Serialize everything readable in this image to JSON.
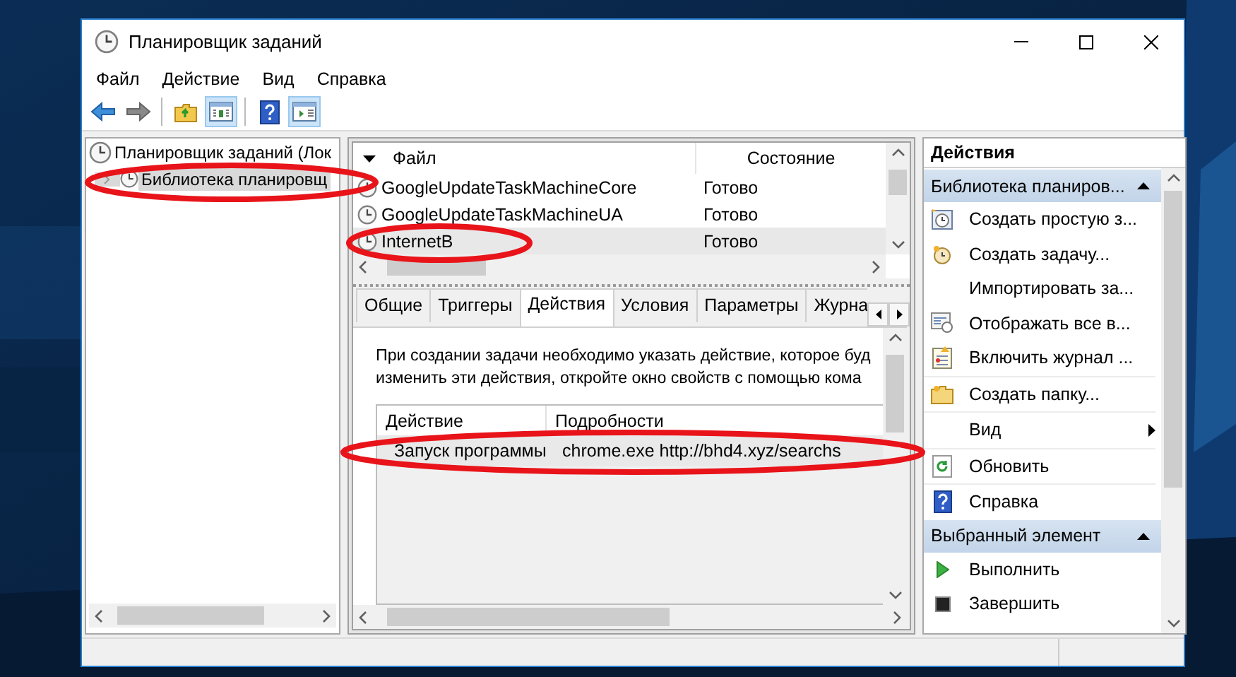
{
  "window": {
    "title": "Планировщик заданий"
  },
  "menu": [
    "Файл",
    "Действие",
    "Вид",
    "Справка"
  ],
  "toolbar": [
    {
      "pressed": false
    },
    {
      "pressed": false
    },
    {
      "pressed": false
    },
    {
      "pressed": true
    },
    {
      "pressed": false
    },
    {
      "pressed": true
    }
  ],
  "tree": [
    {
      "label": "Планировщик заданий (Лок",
      "selected": false,
      "children": [
        {
          "label": "Библиотека планировщ",
          "selected": true,
          "expanded": false
        }
      ]
    }
  ],
  "task_list": {
    "columns": [
      "Файл",
      "Состояние"
    ],
    "rows": [
      {
        "name": "GoogleUpdateTaskMachineCore",
        "status": "Готово",
        "selected": false
      },
      {
        "name": "GoogleUpdateTaskMachineUA",
        "status": "Готово",
        "selected": false
      },
      {
        "name": "InternetB",
        "status": "Готово",
        "selected": true
      }
    ]
  },
  "detail_tabs": [
    {
      "label": "Общие",
      "selected": false
    },
    {
      "label": "Триггеры",
      "selected": false
    },
    {
      "label": "Действия",
      "selected": true
    },
    {
      "label": "Условия",
      "selected": false
    },
    {
      "label": "Параметры",
      "selected": false
    },
    {
      "label": "Журна",
      "selected": false
    }
  ],
  "actions_tab": {
    "description": [
      "При создании задачи необходимо указать действие, которое буд",
      "изменить эти действия, откройте окно свойств с помощью кома"
    ],
    "table": {
      "columns": [
        "Действие",
        "Подробности"
      ],
      "rows": [
        {
          "action": "Запуск программы",
          "details": "chrome.exe http://bhd4.xyz/searchs"
        }
      ]
    }
  },
  "actions_pane": {
    "title": "Действия",
    "sections": [
      {
        "title": "Библиотека планиров...",
        "expanded": true,
        "items": [
          {
            "label": "Создать простую з...",
            "kind": "command"
          },
          {
            "label": "Создать задачу...",
            "kind": "command"
          },
          {
            "label": "Импортировать за...",
            "kind": "command"
          },
          {
            "label": "Отображать все в...",
            "kind": "command"
          },
          {
            "label": "Включить журнал ...",
            "kind": "command"
          },
          {
            "label": "Создать папку...",
            "kind": "command"
          },
          {
            "label": "Вид",
            "kind": "submenu"
          },
          {
            "label": "Обновить",
            "kind": "command"
          },
          {
            "label": "Справка",
            "kind": "command"
          }
        ]
      },
      {
        "title": "Выбранный элемент",
        "expanded": true,
        "items": [
          {
            "label": "Выполнить",
            "kind": "command"
          },
          {
            "label": "Завершить",
            "kind": "command"
          }
        ]
      }
    ]
  }
}
